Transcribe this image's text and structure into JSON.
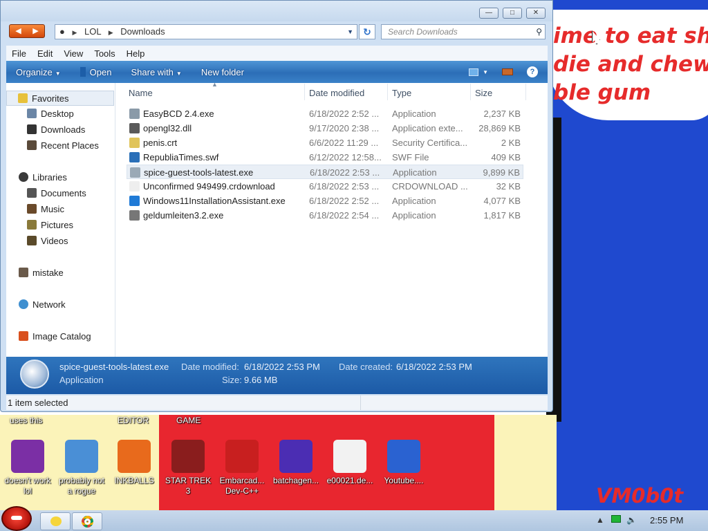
{
  "desktop": {
    "bubble_text": "ime to eat shit\ndie and chew\nble gum",
    "signature": "VM0b0t",
    "top_labels": [
      "uses this",
      "EDITOR",
      "GAME"
    ],
    "icons": [
      {
        "label": "doesn't work lol",
        "icon": "yahoo-messenger-icon",
        "color": "#7b2fa5"
      },
      {
        "label": "probably not a rogue",
        "icon": "system-settings-icon",
        "color": "#4a8fd6"
      },
      {
        "label": "INKBALLS",
        "icon": "inkball-icon",
        "color": "#e86a1c"
      },
      {
        "label": "STAR TREK 3",
        "icon": "star-trek-icon",
        "color": "#8a1d1d"
      },
      {
        "label": "Embarcad... Dev-C++",
        "icon": "dev-cpp-icon",
        "color": "#c81f1f"
      },
      {
        "label": "batchagen...",
        "icon": "batchagen-icon",
        "color": "#4b2db3"
      },
      {
        "label": "e00021.de...",
        "icon": "document-icon",
        "color": "#f2f2f2"
      },
      {
        "label": "Youtube....",
        "icon": "google-icon",
        "color": "#2a62d1"
      }
    ]
  },
  "window": {
    "breadcrumb": [
      "LOL",
      "Downloads"
    ],
    "search_placeholder": "Search Downloads",
    "menu": [
      "File",
      "Edit",
      "View",
      "Tools",
      "Help"
    ],
    "toolbar": {
      "organize": "Organize",
      "open": "Open",
      "share": "Share with",
      "new_folder": "New folder",
      "help": "?"
    },
    "nav": {
      "favorites": "Favorites",
      "favorites_items": [
        "Desktop",
        "Downloads",
        "Recent Places"
      ],
      "libraries": "Libraries",
      "libraries_items": [
        "Documents",
        "Music",
        "Pictures",
        "Videos"
      ],
      "mistake": "mistake",
      "network": "Network",
      "image_catalog": "Image Catalog"
    },
    "columns": {
      "name": "Name",
      "date": "Date modified",
      "type": "Type",
      "size": "Size"
    },
    "files": [
      {
        "name": "EasyBCD 2.4.exe",
        "date": "6/18/2022 2:52 ...",
        "type": "Application",
        "size": "2,237 KB",
        "icon": "application-icon",
        "color": "#8a9aa8"
      },
      {
        "name": "opengl32.dll",
        "date": "9/17/2020 2:38 ...",
        "type": "Application exte...",
        "size": "28,869 KB",
        "icon": "dll-icon",
        "color": "#5a5a5a"
      },
      {
        "name": "penis.crt",
        "date": "6/6/2022 11:29 ...",
        "type": "Security Certifica...",
        "size": "2 KB",
        "icon": "certificate-icon",
        "color": "#e0c45a"
      },
      {
        "name": "RepubliaTimes.swf",
        "date": "6/12/2022 12:58...",
        "type": "SWF File",
        "size": "409 KB",
        "icon": "swf-icon",
        "color": "#2a6fb8"
      },
      {
        "name": "spice-guest-tools-latest.exe",
        "date": "6/18/2022 2:53 ...",
        "type": "Application",
        "size": "9,899 KB",
        "icon": "installer-icon",
        "color": "#9aa9b6"
      },
      {
        "name": "Unconfirmed 949499.crdownload",
        "date": "6/18/2022 2:53 ...",
        "type": "CRDOWNLOAD ...",
        "size": "32 KB",
        "icon": "blank-file-icon",
        "color": "#eeeeee"
      },
      {
        "name": "Windows11InstallationAssistant.exe",
        "date": "6/18/2022 2:52 ...",
        "type": "Application",
        "size": "4,077 KB",
        "icon": "windows-logo-icon",
        "color": "#1f7ad6"
      },
      {
        "name": "geldumleiten3.2.exe",
        "date": "6/18/2022 2:54 ...",
        "type": "Application",
        "size": "1,817 KB",
        "icon": "setup-icon",
        "color": "#777777"
      }
    ],
    "selected_index": 4,
    "details": {
      "name": "spice-guest-tools-latest.exe",
      "type": "Application",
      "modified_label": "Date modified:",
      "modified_value": "6/18/2022 2:53 PM",
      "created_label": "Date created:",
      "created_value": "6/18/2022 2:53 PM",
      "size_label": "Size:",
      "size_value": "9.66 MB"
    },
    "status": "1 item selected"
  },
  "taskbar": {
    "clock": "2:55 PM"
  }
}
